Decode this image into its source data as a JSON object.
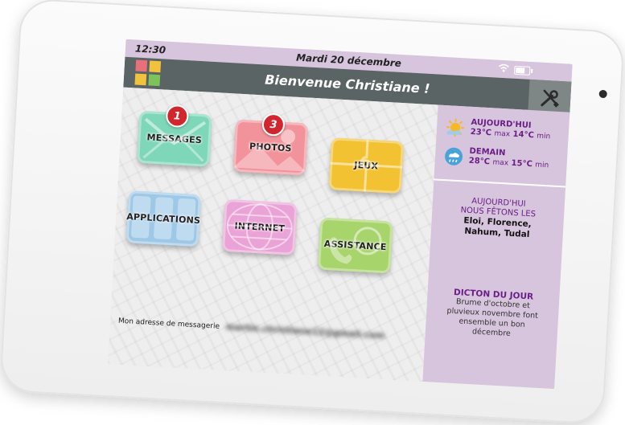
{
  "statusbar": {
    "time": "12:30",
    "date": "Mardi 20 décembre"
  },
  "header": {
    "welcome": "Bienvenue Christiane !"
  },
  "tiles": [
    {
      "label": "MESSAGES",
      "badge": "1"
    },
    {
      "label": "PHOTOS",
      "badge": "3"
    },
    {
      "label": "JEUX"
    },
    {
      "label": "APPLICATIONS"
    },
    {
      "label": "INTERNET"
    },
    {
      "label": "ASSISTANCE"
    }
  ],
  "email": {
    "label": "Mon adresse de messagerie",
    "value": "martin.christiane12@gmail.com"
  },
  "weather": {
    "today": {
      "title": "AUJOURD'HUI",
      "max": "23°C",
      "max_label": "max",
      "min": "14°C",
      "min_label": "min"
    },
    "tomorrow": {
      "title": "DEMAIN",
      "max": "28°C",
      "max_label": "max",
      "min": "15°C",
      "min_label": "min"
    }
  },
  "fete": {
    "line1": "AUJOURD'HUI",
    "line2": "NOUS FÊTONS LES",
    "names1": "Eloi, Florence,",
    "names2": "Nahum, Tudal"
  },
  "dicton": {
    "title": "DICTON DU JOUR",
    "l1": "Brume d'octobre et",
    "l2": "pluvieux novembre font",
    "l3": "ensemble un bon",
    "l4": "décembre"
  },
  "icons": {
    "settings": "tools-icon",
    "wifi": "wifi-icon",
    "battery": "battery-icon",
    "sun": "sun-icon",
    "rain": "cloud-rain-icon"
  },
  "colors": {
    "header": "#5b6464",
    "sidebar": "#d7c4dd",
    "accent": "#6b1f86",
    "badge": "#d1262e"
  }
}
